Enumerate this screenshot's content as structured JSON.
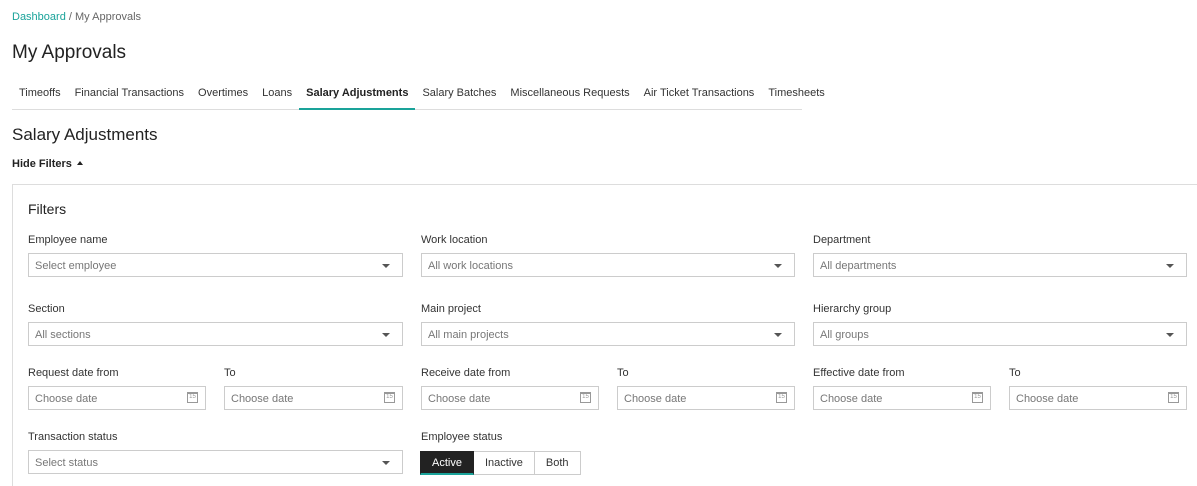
{
  "breadcrumb": {
    "link": "Dashboard",
    "separator": "/",
    "current": "My Approvals"
  },
  "page_title": "My Approvals",
  "tabs": [
    {
      "label": "Timeoffs"
    },
    {
      "label": "Financial Transactions"
    },
    {
      "label": "Overtimes"
    },
    {
      "label": "Loans"
    },
    {
      "label": "Salary Adjustments",
      "active": true
    },
    {
      "label": "Salary Batches"
    },
    {
      "label": "Miscellaneous Requests"
    },
    {
      "label": "Air Ticket Transactions"
    },
    {
      "label": "Timesheets"
    }
  ],
  "section_title": "Salary Adjustments",
  "hide_filters_label": "Hide Filters",
  "filters": {
    "title": "Filters",
    "employee_name": {
      "label": "Employee name",
      "placeholder": "Select employee"
    },
    "work_location": {
      "label": "Work location",
      "placeholder": "All work locations"
    },
    "department": {
      "label": "Department",
      "placeholder": "All departments"
    },
    "section": {
      "label": "Section",
      "placeholder": "All sections"
    },
    "main_project": {
      "label": "Main project",
      "placeholder": "All main projects"
    },
    "hierarchy_group": {
      "label": "Hierarchy group",
      "placeholder": "All groups"
    },
    "request_date_from": {
      "label": "Request date from",
      "placeholder": "Choose date"
    },
    "request_date_to": {
      "label": "To",
      "placeholder": "Choose date"
    },
    "receive_date_from": {
      "label": "Receive date from",
      "placeholder": "Choose date"
    },
    "receive_date_to": {
      "label": "To",
      "placeholder": "Choose date"
    },
    "effective_date_from": {
      "label": "Effective date from",
      "placeholder": "Choose date"
    },
    "effective_date_to": {
      "label": "To",
      "placeholder": "Choose date"
    },
    "transaction_status": {
      "label": "Transaction status",
      "placeholder": "Select status"
    },
    "employee_status": {
      "label": "Employee status",
      "options": [
        "Active",
        "Inactive",
        "Both"
      ],
      "selected": "Active"
    },
    "calendar_icon_text": "15"
  },
  "colors": {
    "accent": "#1aa39a",
    "active_button": "#222222"
  }
}
